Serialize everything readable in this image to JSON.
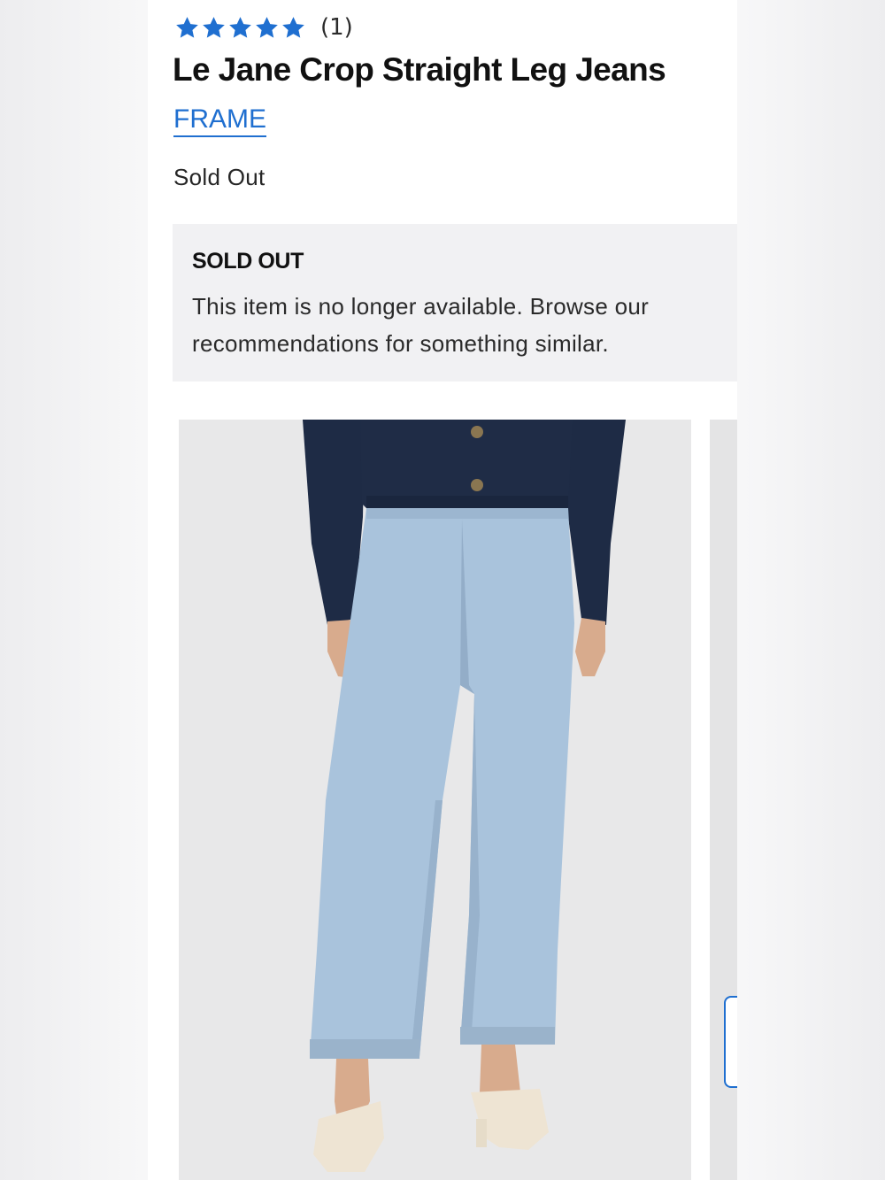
{
  "product": {
    "rating": {
      "value": 5,
      "max": 5,
      "count_label": "(1)",
      "star_color": "#1f6fd0"
    },
    "title": "Le Jane Crop Straight Leg Jeans",
    "brand": "FRAME",
    "status": "Sold Out"
  },
  "notice": {
    "heading": "SOLD OUT",
    "body": "This item is no longer available. Browse our recommendations for something similar."
  },
  "gallery": {
    "images": [
      {
        "subject": "model wearing light wash cropped straight leg jeans with navy cardigan and cream sandals"
      },
      {
        "subject": "next product image (partially visible)"
      }
    ]
  },
  "colors": {
    "accent": "#1f6fd0",
    "notice_bg": "#f1f1f3",
    "denim": "#a9c3dc",
    "cardigan": "#1d2a44"
  }
}
